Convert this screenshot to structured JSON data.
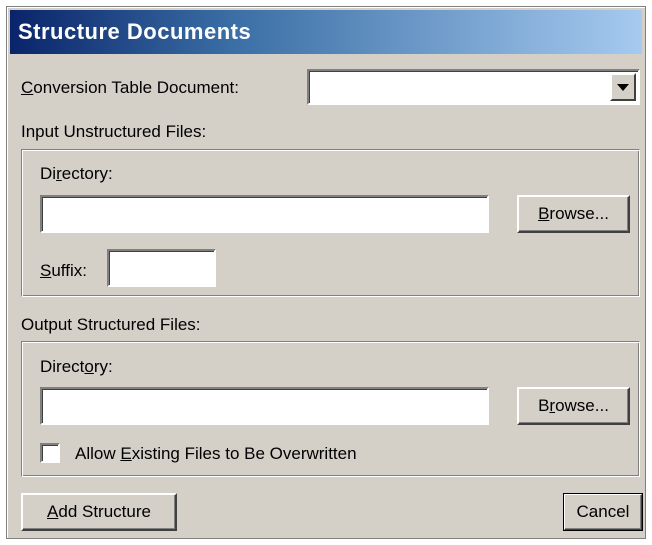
{
  "dialog": {
    "title": "Structure Documents"
  },
  "conversion": {
    "label_pre": "",
    "label_key": "C",
    "label_post": "onversion Table Document:",
    "value": ""
  },
  "input": {
    "section_label": "Input Unstructured Files:",
    "directory_label_pre": "Di",
    "directory_label_key": "r",
    "directory_label_post": "ectory:",
    "directory_value": "",
    "browse_pre": "",
    "browse_key": "B",
    "browse_post": "rowse...",
    "suffix_label_pre": "",
    "suffix_label_key": "S",
    "suffix_label_post": "uffix:",
    "suffix_value": ""
  },
  "output": {
    "section_label": "Output Structured Files:",
    "directory_label_pre": "Direct",
    "directory_label_key": "o",
    "directory_label_post": "ry:",
    "directory_value": "",
    "browse_pre": "B",
    "browse_key": "r",
    "browse_post": "owse...",
    "overwrite_pre": "Allow ",
    "overwrite_key": "E",
    "overwrite_post": "xisting Files to Be Overwritten",
    "overwrite_checked": false
  },
  "footer": {
    "add_pre": "",
    "add_key": "A",
    "add_post": "dd Structure",
    "cancel_label": "Cancel"
  }
}
